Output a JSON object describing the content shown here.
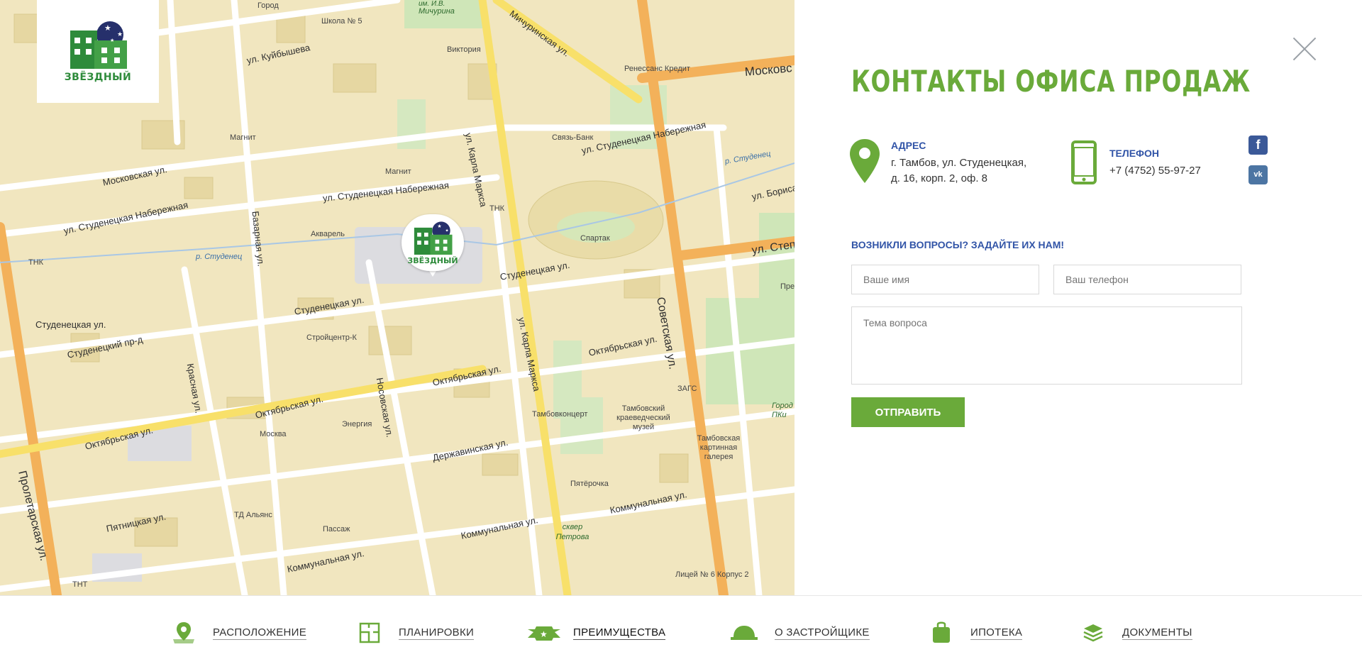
{
  "logo": {
    "text": "ЗВЁЗДНЫЙ",
    "color": "#2e8b3b",
    "accent": "#26306b"
  },
  "map": {
    "marker_text": "ЗВЁЗДНЫЙ",
    "streets": [
      "ул. Куйбышева",
      "Московская ул.",
      "ул. Студенецкая Набережная",
      "ул. Студенецкая Набережная",
      "ул. Студенецкая Набережная",
      "Базарная ул.",
      "ул. Карла Маркса",
      "Мичуринская ул.",
      "Студенецкая ул.",
      "Студенецкая ул.",
      "Студенецкая ул.",
      "Студенецкий пр-д",
      "Октябрьская ул.",
      "Октябрьская ул.",
      "Октябрьская ул.",
      "Октябрьская ул.",
      "Красная ул.",
      "Пролетарская ул.",
      "Носовская ул.",
      "Державинская ул.",
      "Коммунальная ул.",
      "Коммунальная ул.",
      "Коммунальная ул.",
      "Пятницкая ул.",
      "Советская ул.",
      "ул. Бориса",
      "Московс",
      "ул. Карла Маркса",
      "ул. Степ"
    ],
    "rivers": [
      "р. Студенец",
      "р. Студенец"
    ],
    "pois": [
      "Город",
      "Школа № 5",
      "Мичурина",
      "им. И.В.",
      "Виктория",
      "Ренессанс Кредит",
      "Магнит",
      "Связь-Банк",
      "Магнит",
      "Акварель",
      "ТНК",
      "ТНК",
      "Спартак",
      "Стройцентр-К",
      "Энергия",
      "Москва",
      "Тамбовконцерт",
      "Тамбовский краеведческий музей",
      "ЗАГС",
      "Тамбовская картинная галерея",
      "Пятёрочка",
      "ТД Альянс",
      "Пассаж",
      "сквер Петрова",
      "Лицей № 6 Корпус 2",
      "ТНТ",
      "Пре",
      "Город ПКи"
    ]
  },
  "panel": {
    "title": "КОНТАКТЫ ОФИСА ПРОДАЖ",
    "address_label": "АДРЕС",
    "address_line1": "г. Тамбов, ул. Студенецкая,",
    "address_line2": "д. 16, корп. 2, оф. 8",
    "phone_label": "ТЕЛЕФОН",
    "phone_value": "+7 (4752) 55-97-27",
    "form_heading": "ВОЗНИКЛИ ВОПРОСЫ? ЗАДАЙТЕ ИХ НАМ!",
    "name_placeholder": "Ваше имя",
    "phone_placeholder": "Ваш телефон",
    "topic_placeholder": "Тема вопроса",
    "submit_label": "ОТПРАВИТЬ",
    "social": {
      "facebook": "f",
      "vk": "vk"
    },
    "accent_green": "#6aaa3a",
    "accent_blue": "#3154a7"
  },
  "nav": [
    {
      "label": "РАСПОЛОЖЕНИЕ",
      "icon": "location-pin-icon"
    },
    {
      "label": "ПЛАНИРОВКИ",
      "icon": "floor-plan-icon"
    },
    {
      "label": "ПРЕИМУЩЕСТВА",
      "icon": "star-ribbon-icon",
      "active": true
    },
    {
      "label": "О ЗАСТРОЙЩИКЕ",
      "icon": "hard-hat-icon"
    },
    {
      "label": "ИПОТЕКА",
      "icon": "bag-icon"
    },
    {
      "label": "ДОКУМЕНТЫ",
      "icon": "stack-icon"
    }
  ]
}
